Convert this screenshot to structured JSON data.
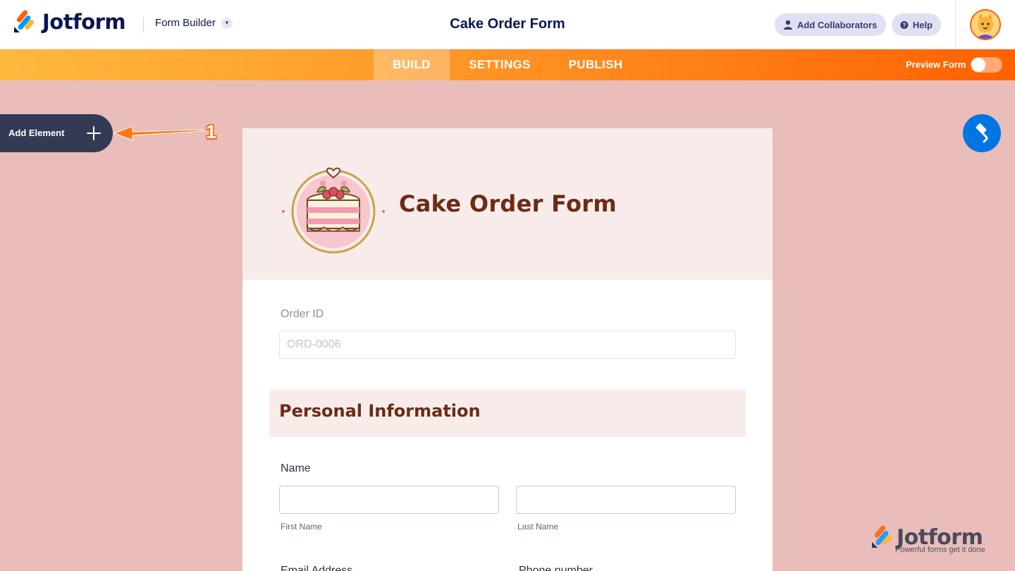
{
  "header": {
    "brand": "Jotform",
    "builder_menu": "Form Builder",
    "form_title": "Cake Order Form",
    "add_collaborators": "Add Collaborators",
    "help": "Help"
  },
  "nav": {
    "tabs": [
      {
        "label": "BUILD",
        "active": true
      },
      {
        "label": "SETTINGS",
        "active": false
      },
      {
        "label": "PUBLISH",
        "active": false
      }
    ],
    "preview_label": "Preview Form",
    "preview_on": false
  },
  "sidebar": {
    "add_element": "Add Element",
    "callout_number": "1"
  },
  "form": {
    "heading": "Cake Order Form",
    "order_id": {
      "label": "Order ID",
      "placeholder": "ORD-0006"
    },
    "section_title": "Personal Information",
    "name": {
      "label": "Name",
      "first_sublabel": "First Name",
      "last_sublabel": "Last Name"
    },
    "email_label": "Email Address",
    "phone_label": "Phone number"
  },
  "watermark": {
    "name": "Jotform",
    "tagline": "Powerful forms get it done"
  },
  "colors": {
    "canvas": "#e9bdb9",
    "header_band": "#f8ecea",
    "heading_text": "#6a2c16",
    "nav_start": "#ffb83f",
    "nav_end": "#ff6100",
    "designer_button": "#0075e3",
    "add_element_bg": "#343a54"
  }
}
